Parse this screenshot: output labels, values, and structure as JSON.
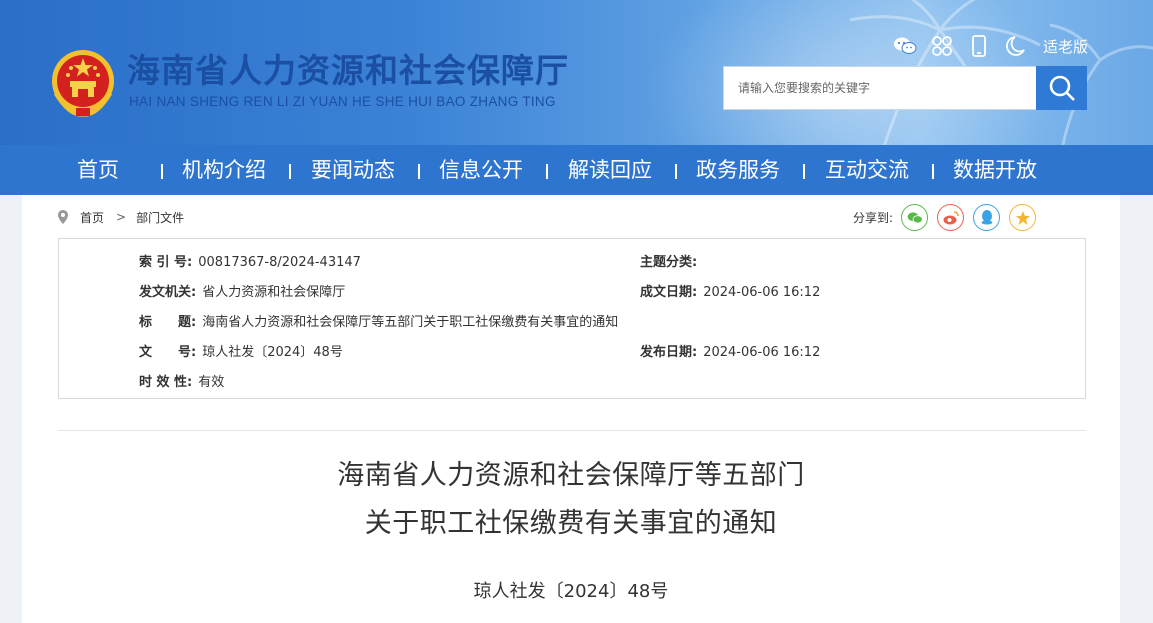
{
  "header": {
    "title": "海南省人力资源和社会保障厅",
    "pinyin": "HAI NAN SHENG REN LI ZI YUAN HE SHE HUI BAO ZHANG TING",
    "elder_mode": "适老版",
    "search_placeholder": "请输入您要搜索的关键字",
    "tool_icons": [
      "wechat-icon",
      "app-grid-icon",
      "mobile-icon",
      "moon-icon"
    ]
  },
  "nav": {
    "items": [
      "首页",
      "机构介绍",
      "要闻动态",
      "信息公开",
      "解读回应",
      "政务服务",
      "互动交流",
      "数据开放"
    ]
  },
  "breadcrumb": {
    "home": "首页",
    "current": "部门文件"
  },
  "share": {
    "label": "分享到:",
    "targets": [
      "wechat-icon",
      "weibo-icon",
      "qq-icon",
      "qzone-icon"
    ]
  },
  "meta": {
    "index_label": "索 引 号:",
    "index_value": "00817367-8/2024-43147",
    "category_label": "主题分类:",
    "category_value": "",
    "issuer_label": "发文机关:",
    "issuer_value": "省人力资源和社会保障厅",
    "created_label": "成文日期:",
    "created_value": "2024-06-06 16:12",
    "title_label": "标　　题:",
    "title_value": "海南省人力资源和社会保障厅等五部门关于职工社保缴费有关事宜的通知",
    "docno_label": "文　　号:",
    "docno_value": "琼人社发〔2024〕48号",
    "published_label": "发布日期:",
    "published_value": "2024-06-06 16:12",
    "validity_label": "时 效 性:",
    "validity_value": "有效"
  },
  "document": {
    "title_line1": "海南省人力资源和社会保障厅等五部门",
    "title_line2": "关于职工社保缴费有关事宜的通知",
    "number": "琼人社发〔2024〕48号"
  },
  "colors": {
    "header_blue": "#2a6ec8",
    "nav_blue": "#2e75cf",
    "title_blue": "#1a4fa3",
    "search_button": "#2f7ad4"
  }
}
